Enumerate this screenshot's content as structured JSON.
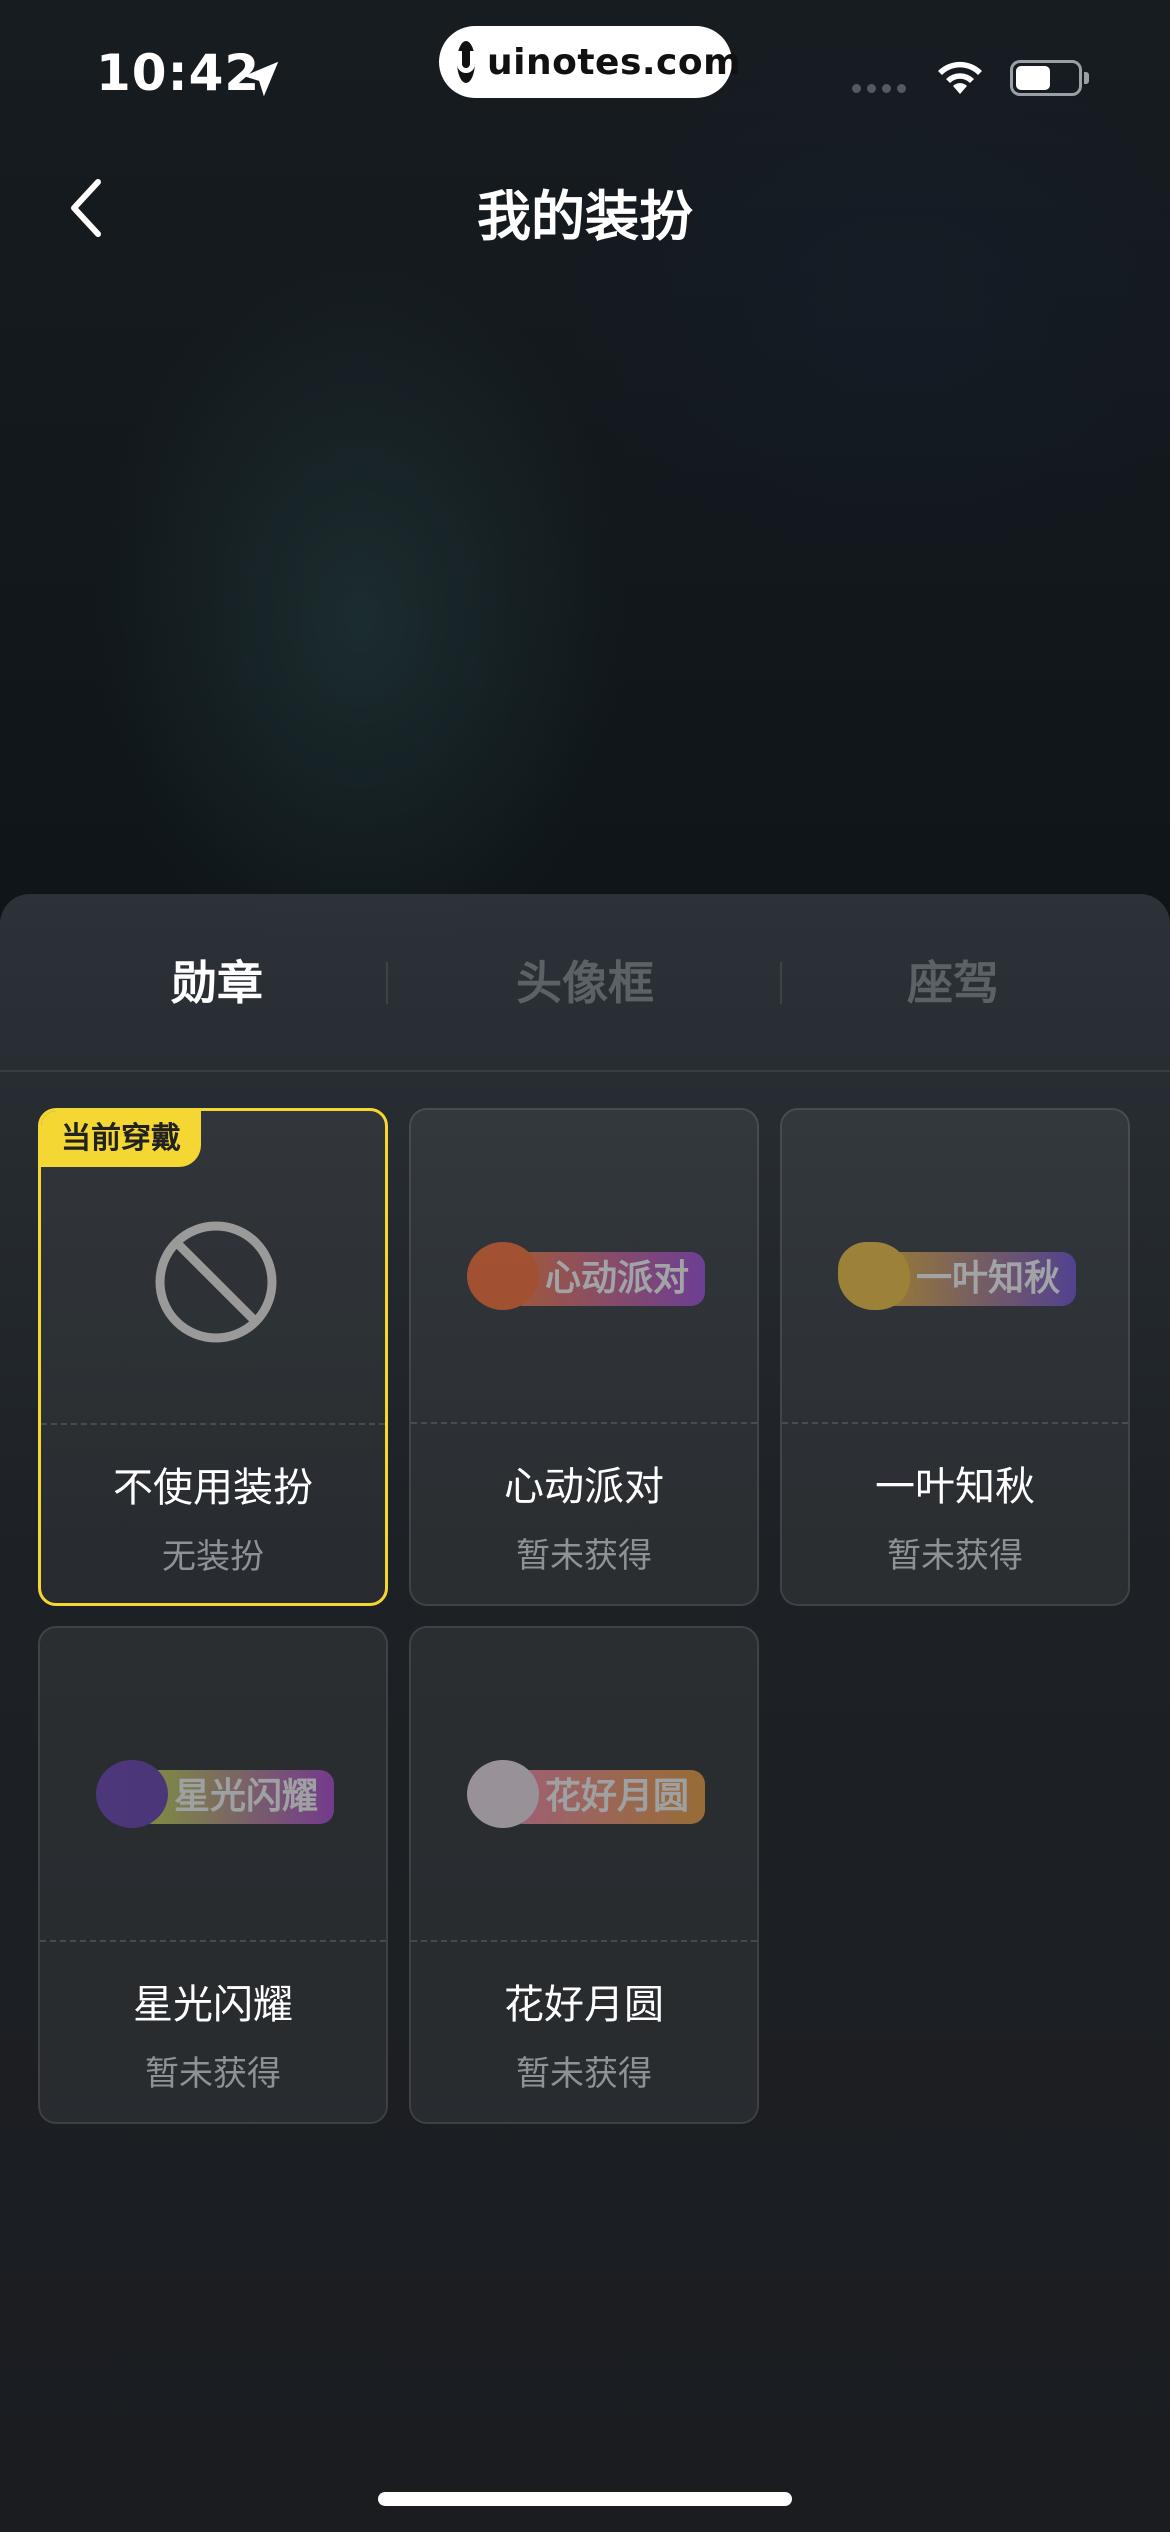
{
  "status_bar": {
    "time": "10:42",
    "url": "uinotes.com"
  },
  "header": {
    "title": "我的装扮"
  },
  "tabs": [
    {
      "label": "勋章",
      "active": true
    },
    {
      "label": "头像框",
      "active": false
    },
    {
      "label": "座驾",
      "active": false
    }
  ],
  "items": [
    {
      "name": "不使用装扮",
      "status": "无装扮",
      "tag": "当前穿戴",
      "icon": "no-symbol-icon",
      "selected": true
    },
    {
      "name": "心动派对",
      "status": "暂未获得",
      "badge_text": "心动派对",
      "badge_colors": [
        "#ff7a3c",
        "#a048e0"
      ]
    },
    {
      "name": "一叶知秋",
      "status": "暂未获得",
      "badge_text": "一叶知秋",
      "badge_colors": [
        "#f2b632",
        "#6f4dd8"
      ]
    },
    {
      "name": "星光闪耀",
      "status": "暂未获得",
      "badge_text": "星光闪耀",
      "badge_colors": [
        "#c9e24a",
        "#b046d8"
      ]
    },
    {
      "name": "花好月圆",
      "status": "暂未获得",
      "badge_text": "花好月圆",
      "badge_colors": [
        "#ff8ab0",
        "#f2a13a"
      ]
    }
  ],
  "colors": {
    "accent": "#f4d733",
    "background": "#0e1114",
    "muted_text": "#8d9297"
  }
}
